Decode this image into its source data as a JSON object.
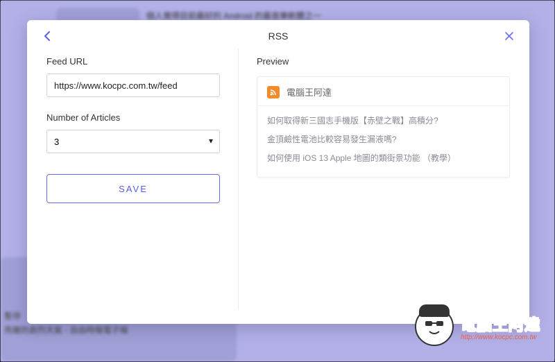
{
  "modal": {
    "title": "RSS"
  },
  "form": {
    "feed_url_label": "Feed URL",
    "feed_url_value": "https://www.kocpc.com.tw/feed",
    "num_articles_label": "Number of Articles",
    "num_articles_value": "3",
    "save_label": "SAVE"
  },
  "preview": {
    "label": "Preview",
    "feed_title": "電腦王阿達",
    "items": [
      "如何取得新三國志手機版【赤壁之戰】高積分?",
      "金頂鹼性電池比較容易發生漏液嗎?",
      "如何使用 iOS 13 Apple 地圖的類街景功能 （教學）"
    ]
  },
  "backdrop": {
    "line1": "雨嚴防劇烈天氣 - 自由時報電子報",
    "line2": "暫停",
    "hdr": "個人覺得目前最好的 Android 的最音樂軟體之一"
  },
  "watermark": {
    "text": "電腦王阿達",
    "url": "http://www.kocpc.com.tw"
  }
}
